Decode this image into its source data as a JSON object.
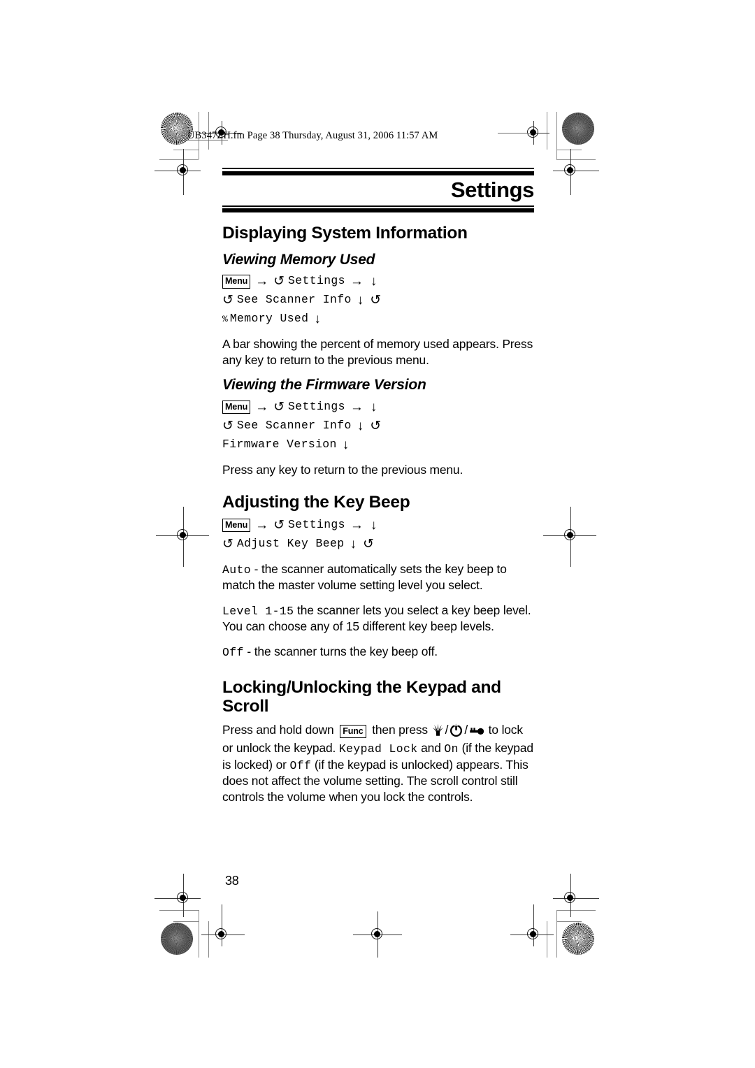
{
  "print_header": {
    "text": "UB347ZH.fm  Page 38  Thursday, August 31, 2006  11:57 AM"
  },
  "chapter": {
    "title": "Settings"
  },
  "sections": [
    {
      "id": "displaying-system-information",
      "heading": "Displaying System Information",
      "subsections": [
        {
          "id": "viewing-memory-used",
          "heading": "Viewing Memory Used",
          "path": {
            "menu_key": "Menu",
            "line1_label": "Settings",
            "line2_label": "See Scanner Info",
            "line3_prefix": "%",
            "line3_label": "Memory Used"
          },
          "paragraphs": [
            "A bar showing the percent of memory used appears. Press any key to return to the previous menu."
          ]
        },
        {
          "id": "viewing-the-firmware-version",
          "heading": "Viewing the Firmware Version",
          "path": {
            "menu_key": "Menu",
            "line1_label": "Settings",
            "line2_label": "See Scanner Info",
            "line3_label": "Firmware Version"
          },
          "paragraphs": [
            "Press any key to return to the previous menu."
          ]
        }
      ]
    },
    {
      "id": "adjusting-the-key-beep",
      "heading": "Adjusting the Key Beep",
      "path": {
        "menu_key": "Menu",
        "line1_label": "Settings",
        "line2_label": "Adjust Key Beep"
      },
      "options": [
        {
          "code": "Auto",
          "separator": " - ",
          "text": "the scanner automatically sets the key beep to match the master volume setting level you select."
        },
        {
          "code": "Level 1-15",
          "separator": "  ",
          "text": "the scanner lets you select a key beep level. You can choose any of 15 different key beep levels."
        },
        {
          "code": "Off",
          "separator": " - ",
          "text": "the scanner turns the key beep off."
        }
      ]
    },
    {
      "id": "locking-unlocking-the-keypad-and-scroll",
      "heading": "Locking/Unlocking the Keypad and Scroll",
      "instruction": {
        "part1": "Press and hold down ",
        "func_key": "Func",
        "part2": " then press ",
        "icons": [
          "light-icon",
          "power-icon",
          "key-icon"
        ],
        "part3": " to lock or unlock the keypad. ",
        "code1": "Keypad Lock",
        "part4": " and ",
        "code2": "On",
        "part5": " (if the keypad is locked) or ",
        "code3": "Off",
        "part6": " (if the keypad is unlocked) appears. This does not affect the volume setting. The scroll control still controls the volume when you lock the controls."
      }
    }
  ],
  "footer": {
    "page_number": "38"
  },
  "glyphs": {
    "scroll": "↺",
    "arrow_right": "→",
    "arrow_down": "↓",
    "slash": "/"
  },
  "colors": {
    "text": "#000000",
    "rule": "#000000",
    "crop_mark": "#8a8a8a"
  }
}
